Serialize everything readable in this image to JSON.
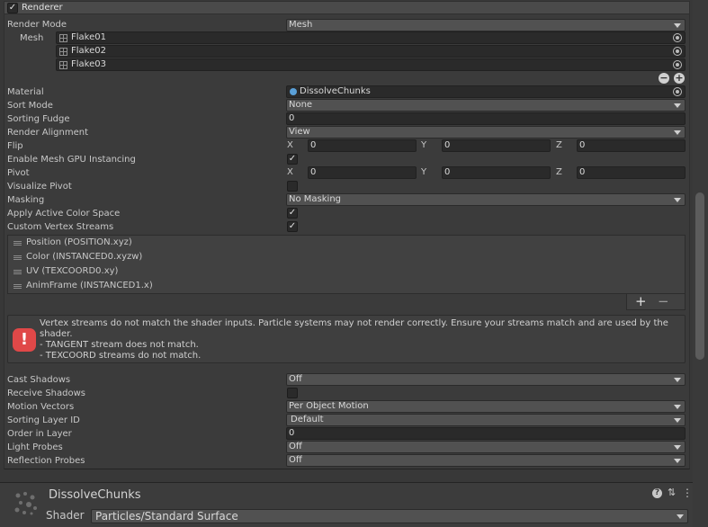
{
  "renderer": {
    "header_title": "Renderer",
    "enabled_check": "✓",
    "fields": {
      "render_mode": {
        "label": "Render Mode",
        "value": "Mesh"
      },
      "mesh": {
        "label": "Mesh",
        "items": [
          "Flake01",
          "Flake02",
          "Flake03"
        ]
      },
      "material": {
        "label": "Material",
        "value": "DissolveChunks"
      },
      "sort_mode": {
        "label": "Sort Mode",
        "value": "None"
      },
      "sorting_fudge": {
        "label": "Sorting Fudge",
        "value": "0"
      },
      "render_alignment": {
        "label": "Render Alignment",
        "value": "View"
      },
      "flip": {
        "label": "Flip",
        "x": "0",
        "y": "0",
        "z": "0"
      },
      "gpu_instancing": {
        "label": "Enable Mesh GPU Instancing",
        "checked": "✓"
      },
      "pivot": {
        "label": "Pivot",
        "x": "0",
        "y": "0",
        "z": "0"
      },
      "visualize_pivot": {
        "label": "Visualize Pivot",
        "checked": ""
      },
      "masking": {
        "label": "Masking",
        "value": "No Masking"
      },
      "active_color_space": {
        "label": "Apply Active Color Space",
        "checked": "✓"
      },
      "custom_vertex_streams": {
        "label": "Custom Vertex Streams",
        "checked": "✓"
      },
      "cast_shadows": {
        "label": "Cast Shadows",
        "value": "Off"
      },
      "receive_shadows": {
        "label": "Receive Shadows",
        "checked": ""
      },
      "motion_vectors": {
        "label": "Motion Vectors",
        "value": "Per Object Motion"
      },
      "sorting_layer": {
        "label": "Sorting Layer ID",
        "value": "Default"
      },
      "order_in_layer": {
        "label": "Order in Layer",
        "value": "0"
      },
      "light_probes": {
        "label": "Light Probes",
        "value": "Off"
      },
      "reflection_probes": {
        "label": "Reflection Probes",
        "value": "Off"
      }
    },
    "axes": {
      "x": "X",
      "y": "Y",
      "z": "Z"
    },
    "streams": [
      "Position (POSITION.xyz)",
      "Color (INSTANCED0.xyzw)",
      "UV (TEXCOORD0.xy)",
      "AnimFrame (INSTANCED1.x)"
    ],
    "list_buttons": {
      "add": "+",
      "remove": "−"
    },
    "mesh_buttons": {
      "add": "+",
      "remove": "−"
    },
    "warning": {
      "icon": "!",
      "line1": "Vertex streams do not match the shader inputs. Particle systems may not render correctly. Ensure your streams match and are used by the shader.",
      "line2": "- TANGENT stream does not match.",
      "line3": "- TEXCOORD streams do not match."
    }
  },
  "material_panel": {
    "name": "DissolveChunks",
    "shader_label": "Shader",
    "shader_value": "Particles/Standard Surface",
    "icons": {
      "help": "?",
      "settings": "⇅",
      "more": "⋮"
    }
  },
  "colors": {
    "error": "#e04848",
    "background": "#383838"
  }
}
